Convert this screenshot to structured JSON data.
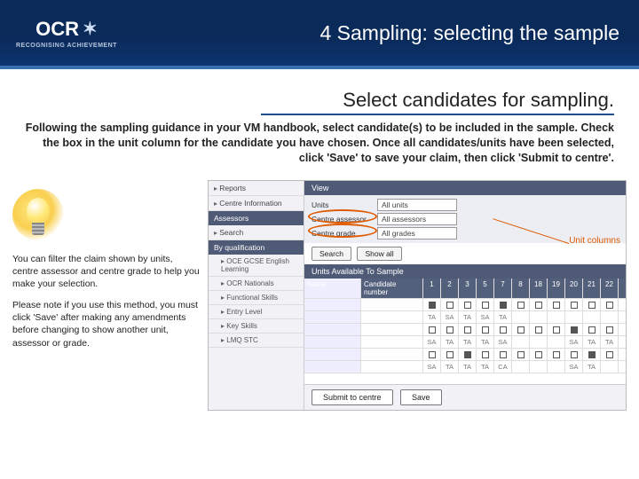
{
  "header": {
    "logo_text": "OCR",
    "logo_sub": "RECOGNISING ACHIEVEMENT",
    "title": "4 Sampling: selecting the sample"
  },
  "subtitle": "Select candidates for sampling.",
  "body_text": "Following the sampling guidance in your VM handbook, select candidate(s) to be included in the sample. Check the box in the unit column for the candidate you have chosen. Once all candidates/units have been selected, click 'Save' to save your claim, then click 'Submit to centre'.",
  "side_note_1": "You can filter the claim shown by units, centre assessor and centre grade to help you make your selection.",
  "side_note_2": "Please note if you use this method, you must click 'Save' after making any amendments before changing to show another unit, assessor or grade.",
  "annotation": "Unit columns",
  "app": {
    "sidebar": {
      "items": [
        "Reports",
        "Centre Information",
        "Assessors",
        "Search",
        "By qualification"
      ],
      "qual_hdr": "By qualification",
      "quals": [
        "OCE GCSE English Learning",
        "OCR Nationals",
        "Functional Skills",
        "Entry Level",
        "Key Skills",
        "LMQ STC"
      ]
    },
    "main": {
      "view_label": "View",
      "filters": {
        "units": {
          "label": "Units",
          "value": "All units"
        },
        "assessor": {
          "label": "Centre assessor",
          "value": "All assessors"
        },
        "grade": {
          "label": "Centre grade",
          "value": "All grades"
        }
      },
      "search_btn": "Search",
      "showall_btn": "Show all",
      "grid_title": "Units Available To Sample",
      "col_name": "Name",
      "col_cand": "Candidate number",
      "unit_cols": [
        "1",
        "2",
        "3",
        "5",
        "7",
        "8",
        "18",
        "19",
        "20",
        "21",
        "22"
      ],
      "rows": [
        {
          "name": "",
          "cand": "",
          "cells": [
            "ck",
            "",
            "",
            "",
            "ck",
            "",
            "",
            "",
            "",
            "",
            ""
          ],
          "sub": [
            "TA",
            "SA",
            "TA",
            "SA",
            "TA",
            "",
            "",
            "",
            "",
            "",
            ""
          ]
        },
        {
          "name": "",
          "cand": "",
          "cells": [
            "",
            "",
            "",
            "",
            "",
            "",
            "",
            "",
            "ck",
            "",
            ""
          ],
          "sub": [
            "SA",
            "TA",
            "TA",
            "TA",
            "SA",
            "",
            "",
            "",
            "SA",
            "TA",
            "TA"
          ]
        },
        {
          "name": "",
          "cand": "",
          "cells": [
            "",
            "",
            "ck",
            "",
            "",
            "",
            "",
            "",
            "",
            "ck",
            ""
          ],
          "sub": [
            "SA",
            "TA",
            "TA",
            "TA",
            "CA",
            "",
            "",
            "",
            "SA",
            "TA",
            ""
          ]
        }
      ],
      "submit_btn": "Submit to centre",
      "save_btn": "Save"
    }
  }
}
